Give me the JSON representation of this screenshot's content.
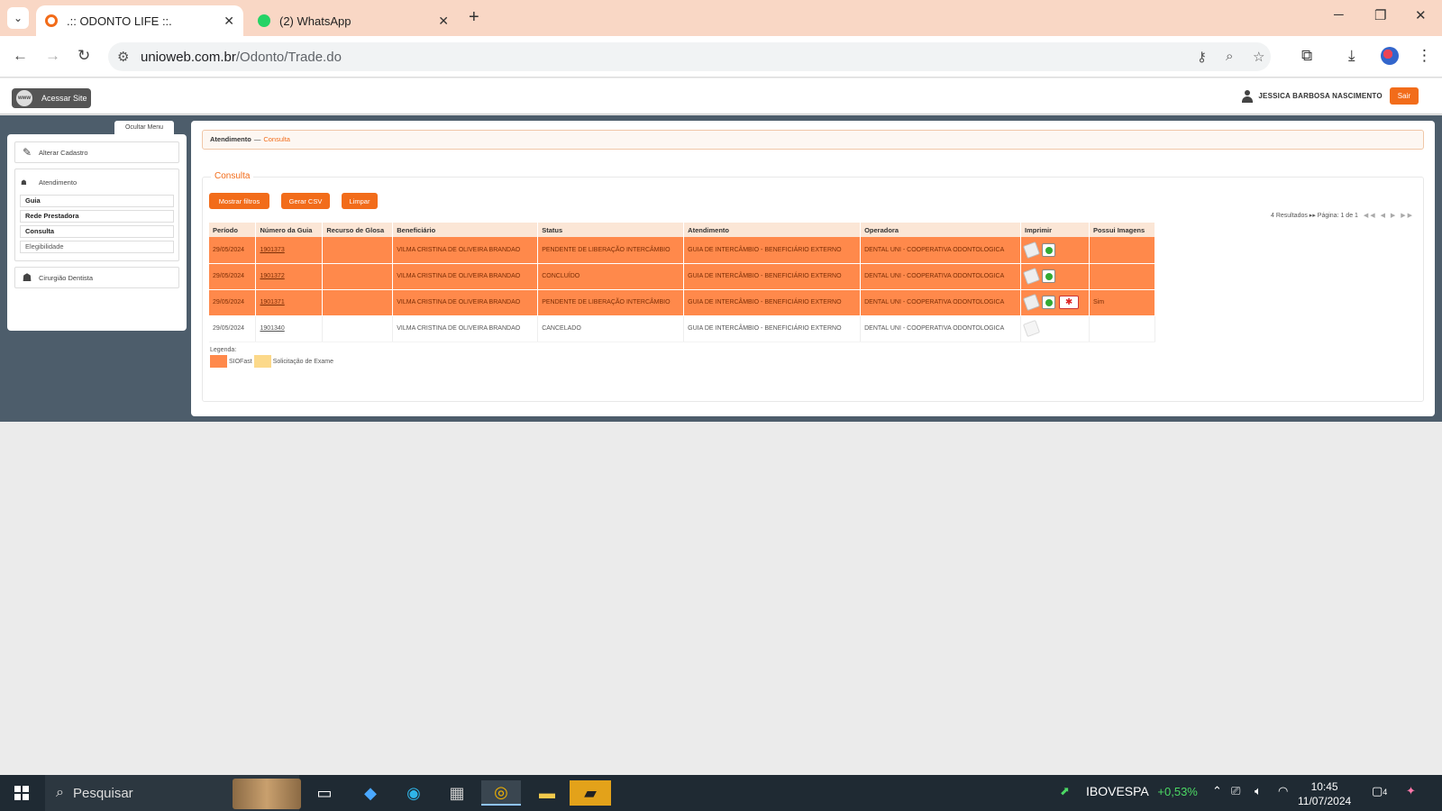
{
  "browser": {
    "tabs": [
      {
        "title": ".:: ODONTO LIFE ::.",
        "active": true,
        "favicon_color": "#f26c1a"
      },
      {
        "title": "(2) WhatsApp",
        "active": false,
        "favicon_color": "#25d366"
      }
    ],
    "url_host": "unioweb.com.br",
    "url_path": "/Odonto/Trade.do"
  },
  "header": {
    "site_button": "Acessar Site",
    "www_badge": "www",
    "user_name": "JESSICA BARBOSA NASCIMENTO",
    "logout": "Sair"
  },
  "sidebar": {
    "toggle": "Ocultar Menu",
    "alterar": "Alterar Cadastro",
    "atendimento": "Atendimento",
    "sub_items": [
      "Guia",
      "Rede Prestadora",
      "Consulta",
      "Elegibilidade"
    ],
    "cirurgiao": "Cirurgião Dentista"
  },
  "breadcrumb": {
    "first": "Atendimento",
    "sep": "—",
    "current": "Consulta"
  },
  "section": {
    "title": "Consulta",
    "buttons": {
      "filtros": "Mostrar filtros",
      "csv": "Gerar CSV",
      "limpar": "Limpar"
    },
    "pager_text": "4 Resultados ▸▸ Página: 1 de 1",
    "pager_arrows": "◀◀ ◀ ▶ ▶▶"
  },
  "table": {
    "headers": [
      "Período",
      "Número da Guia",
      "Recurso de Glosa",
      "Beneficiário",
      "Status",
      "Atendimento",
      "Operadora",
      "Imprimir",
      "Possui Imagens"
    ],
    "rows": [
      {
        "periodo": "29/05/2024",
        "guia": "1901373",
        "glosa": "",
        "beneficiario": "VILMA CRISTINA DE OLIVEIRA BRANDAO",
        "status": "PENDENTE DE LIBERAÇÃO INTERCÂMBIO",
        "atendimento": "GUIA DE INTERCÂMBIO - BENEFICIÁRIO EXTERNO",
        "operadora": "DENTAL UNI - COOPERATIVA ODONTOLOGICA",
        "imagens": ""
      },
      {
        "periodo": "29/05/2024",
        "guia": "1901372",
        "glosa": "",
        "beneficiario": "VILMA CRISTINA DE OLIVEIRA BRANDAO",
        "status": "CONCLUÍDO",
        "atendimento": "GUIA DE INTERCÂMBIO - BENEFICIÁRIO EXTERNO",
        "operadora": "DENTAL UNI - COOPERATIVA ODONTOLOGICA",
        "imagens": ""
      },
      {
        "periodo": "29/05/2024",
        "guia": "1901371",
        "glosa": "",
        "beneficiario": "VILMA CRISTINA DE OLIVEIRA BRANDAO",
        "status": "PENDENTE DE LIBERAÇÃO INTERCÂMBIO",
        "atendimento": "GUIA DE INTERCÂMBIO - BENEFICIÁRIO EXTERNO",
        "operadora": "DENTAL UNI - COOPERATIVA ODONTOLOGICA",
        "imagens": "Sim"
      },
      {
        "periodo": "29/05/2024",
        "guia": "1901340",
        "glosa": "",
        "beneficiario": "VILMA CRISTINA DE OLIVEIRA BRANDAO",
        "status": "CANCELADO",
        "atendimento": "GUIA DE INTERCÂMBIO - BENEFICIÁRIO EXTERNO",
        "operadora": "DENTAL UNI - COOPERATIVA ODONTOLOGICA",
        "imagens": ""
      }
    ]
  },
  "legend": {
    "label": "Legenda:",
    "items": [
      {
        "label": "SIOFast",
        "color": "#ff894b"
      },
      {
        "label": "Solicitação de Exame",
        "color": "#fcd98a"
      }
    ]
  },
  "taskbar": {
    "search": "Pesquisar",
    "ticker_name": "IBOVESPA",
    "ticker_value": "+0,53%",
    "time": "10:45",
    "date": "11/07/2024",
    "notif_count": "4"
  },
  "colors": {
    "accent": "#f26c1a",
    "sio_row": "#ff894b",
    "band": "#4d5d6b"
  }
}
